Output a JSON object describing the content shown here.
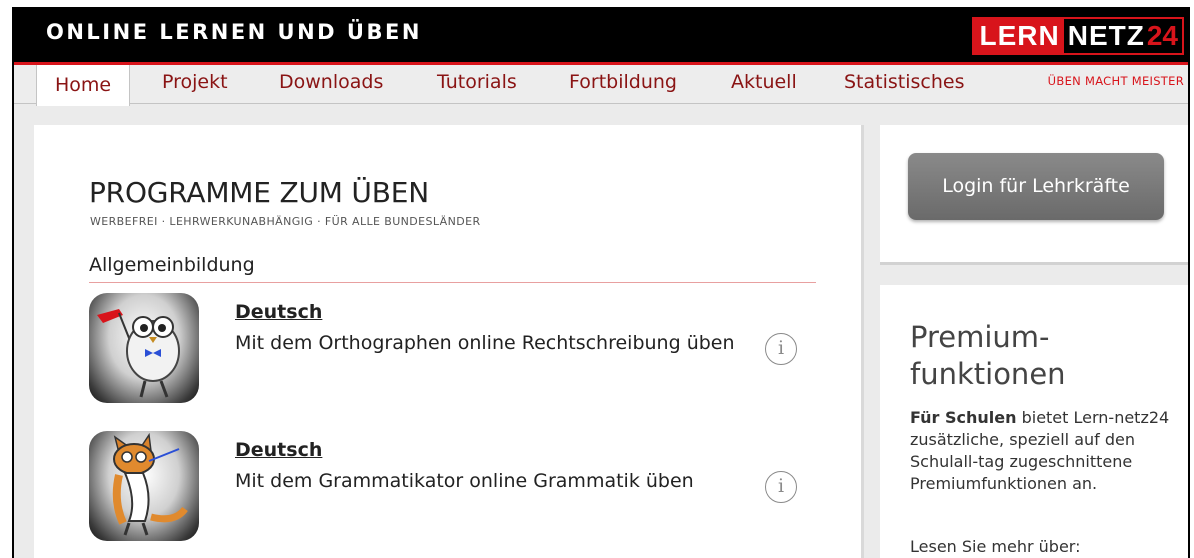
{
  "header": {
    "title": "ONLINE LERNEN UND ÜBEN",
    "logo": {
      "part1": "LERN",
      "part2": "NETZ",
      "part3": "24"
    }
  },
  "nav": {
    "items": [
      {
        "label": "Home"
      },
      {
        "label": "Projekt"
      },
      {
        "label": "Downloads"
      },
      {
        "label": "Tutorials"
      },
      {
        "label": "Fortbildung"
      },
      {
        "label": "Aktuell"
      },
      {
        "label": "Statistisches"
      }
    ],
    "slogan": "ÜBEN MACHT MEISTER"
  },
  "main": {
    "title": "PROGRAMME ZUM ÜBEN",
    "tagline": "WERBEFREI · LEHRWERKUNABHÄNGIG · FÜR ALLE BUNDESLÄNDER",
    "section": "Allgemeinbildung",
    "programs": [
      {
        "subject": "Deutsch",
        "description": "Mit dem Orthographen online Rechtschreibung üben",
        "info_icon": "info-icon",
        "thumb_icon": "owl-mascot-icon"
      },
      {
        "subject": "Deutsch",
        "description": "Mit dem Grammatikator online Grammatik üben",
        "info_icon": "info-icon",
        "thumb_icon": "cat-mascot-icon"
      }
    ]
  },
  "sidebar": {
    "login_label": "Login für Lehrkräfte",
    "premium_title": "Premium-funktionen",
    "premium_bold": "Für Schulen",
    "premium_text": " bietet Lern-netz24 zusätzliche, speziell auf den Schulall-tag zugeschnittene Premiumfunktionen an.",
    "more": "Lesen Sie mehr über:"
  },
  "colors": {
    "accent": "#d8141b",
    "nav_text": "#8a1414",
    "header_bg": "#000000",
    "button_bg": "#7a7a7a"
  }
}
